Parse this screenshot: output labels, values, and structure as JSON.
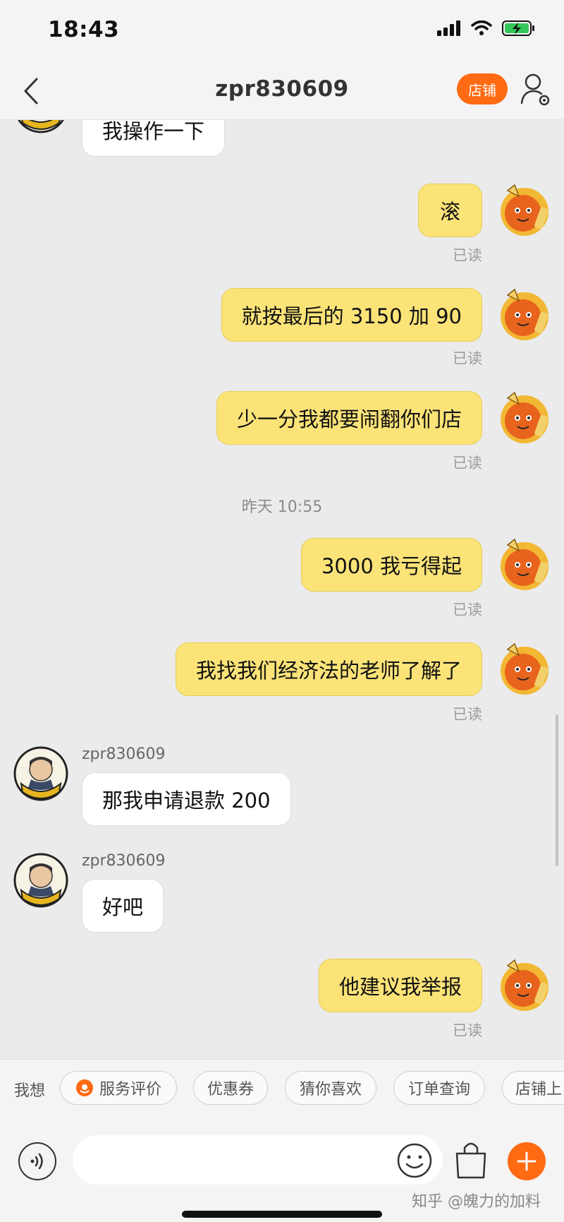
{
  "status_bar": {
    "time": "18:43"
  },
  "nav": {
    "title": "zpr830609",
    "shop_label": "店铺"
  },
  "messages": [
    {
      "dir": "in",
      "text": "我操作一下"
    },
    {
      "dir": "out",
      "text": "滚",
      "status": "已读"
    },
    {
      "dir": "out",
      "text": "就按最后的 3150 加 90",
      "status": "已读"
    },
    {
      "dir": "out",
      "text": "少一分我都要闹翻你们店",
      "status": "已读"
    },
    {
      "dir": "out",
      "text": "3000 我亏得起",
      "status": "已读"
    },
    {
      "dir": "out",
      "text": "我找我们经济法的老师了解了",
      "status": "已读"
    },
    {
      "dir": "in",
      "sender": "zpr830609",
      "text": "那我申请退款 200"
    },
    {
      "dir": "in",
      "sender": "zpr830609",
      "text": "好吧"
    },
    {
      "dir": "out",
      "text": "他建议我举报",
      "status": "已读"
    }
  ],
  "timestamp": "昨天 10:55",
  "quick_bar": {
    "label": "我想",
    "chips": [
      "服务评价",
      "优惠券",
      "猜你喜欢",
      "订单查询",
      "店铺上"
    ]
  },
  "input": {
    "placeholder": ""
  },
  "watermark": "知乎 @魄力的加料",
  "colors": {
    "accent": "#ff6a13",
    "outgoing_bubble": "#fbe378",
    "incoming_bubble": "#ffffff"
  }
}
